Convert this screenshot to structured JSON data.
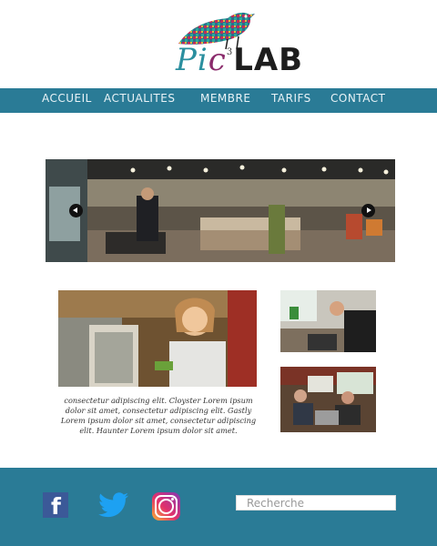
{
  "brand": {
    "logo_prefix": "Pi",
    "logo_c": "c",
    "logo_sup": "3",
    "logo_suffix": "LAB"
  },
  "nav": {
    "items": [
      "ACCUEIL",
      "ACTUALITES",
      "MEMBRE",
      "TARIFS",
      "CONTACT"
    ]
  },
  "slider": {
    "image_alt": "Espace coworking"
  },
  "article": {
    "text": "consectetur adipiscing elit. Cloyster Lorem ipsum dolor sit amet, consectetur adipiscing elit. Gastly Lorem ipsum dolor sit amet, consectetur adipiscing elit. Haunter Lorem ipsum dolor sit amet."
  },
  "footer": {
    "facebook_glyph": "f",
    "search_placeholder": "Recherche"
  },
  "colors": {
    "primary": "#2a7b96",
    "nav_text": "#e9f3f7",
    "background": "#ffffff"
  },
  "icons": [
    "bird-logo-icon",
    "chevron-left-icon",
    "chevron-right-icon",
    "facebook-icon",
    "twitter-icon",
    "instagram-icon"
  ]
}
